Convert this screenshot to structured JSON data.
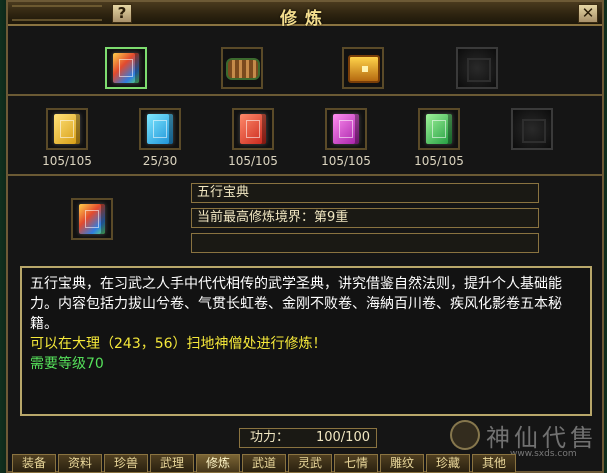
{
  "window": {
    "title": "修炼",
    "help_label": "?",
    "close_label": "✕"
  },
  "top_row": [
    {
      "icon": "multicolor-book-icon",
      "selected": true
    },
    {
      "icon": "scroll-icon",
      "selected": false
    },
    {
      "icon": "treasure-chest-icon",
      "selected": false
    },
    {
      "icon": "empty-slot",
      "selected": false
    }
  ],
  "books": [
    {
      "icon": "gold-book-icon",
      "count": "105/105"
    },
    {
      "icon": "blue-book-icon",
      "count": "25/30"
    },
    {
      "icon": "red-book-icon",
      "count": "105/105"
    },
    {
      "icon": "purple-book-icon",
      "count": "105/105"
    },
    {
      "icon": "green-book-icon",
      "count": "105/105"
    },
    {
      "icon": "empty-slot",
      "count": ""
    }
  ],
  "selected_info": {
    "name": "五行宝典",
    "realm": "当前最高修炼境界：第9重",
    "extra": ""
  },
  "description": {
    "text": "五行宝典，在习武之人手中代代相传的武学圣典，讲究借鉴自然法则，提升个人基础能力。内容包括力拔山兮卷、气贯长虹卷、金刚不败卷、海納百川卷、疾风化影卷五本秘籍。",
    "location": "可以在大理（243，56）扫地神僧处进行修炼！",
    "requirement": "需要等级70"
  },
  "gongli": {
    "label": "功力：",
    "value": "100/100"
  },
  "tabs": [
    "装备",
    "资料",
    "珍兽",
    "武理",
    "修炼",
    "武道",
    "灵武",
    "七情",
    "雕纹",
    "珍藏",
    "其他"
  ],
  "active_tab": "修炼",
  "watermark": {
    "text": "神仙代售",
    "url": "www.sxds.com"
  },
  "colors": {
    "title": "#f3dd8d",
    "location_text": "#f5e83a",
    "requirement_text": "#55e05a",
    "selected_border": "#7ddc6f"
  }
}
